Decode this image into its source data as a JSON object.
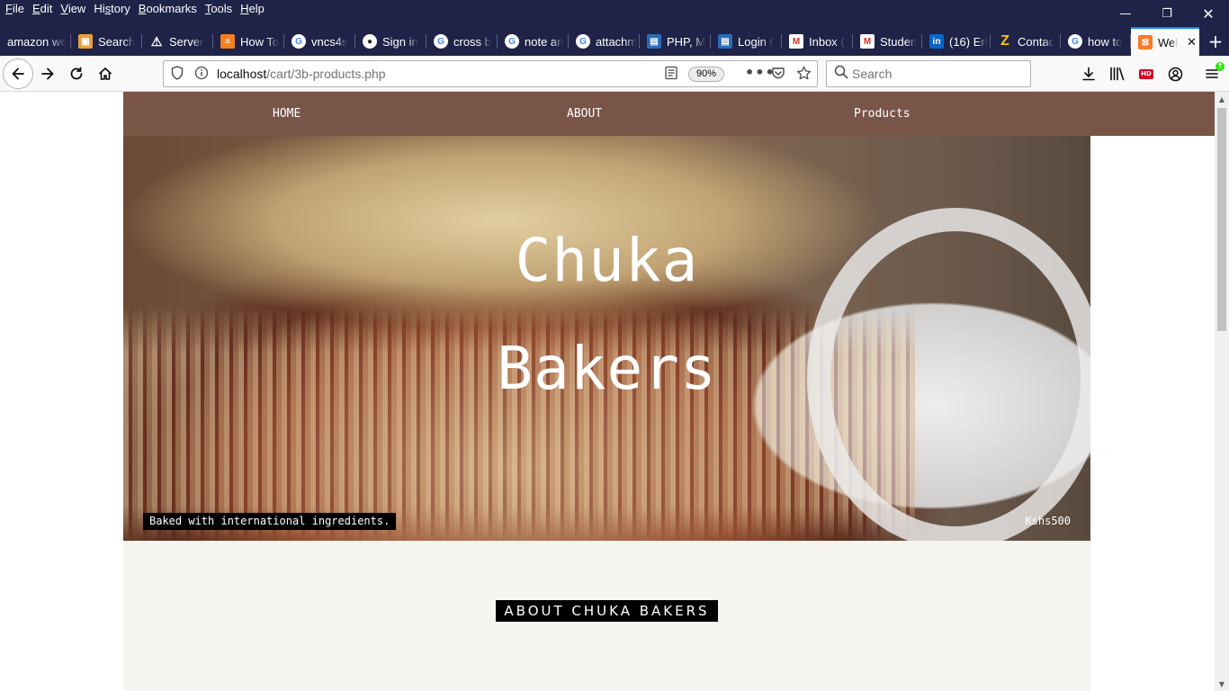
{
  "menubar": {
    "items": [
      {
        "u": "F",
        "rest": "ile"
      },
      {
        "u": "E",
        "rest": "dit"
      },
      {
        "u": "V",
        "rest": "iew"
      },
      {
        "u": "",
        "pre": "Hi",
        "us": "s",
        "post": "tory"
      },
      {
        "u": "B",
        "rest": "ookmarks"
      },
      {
        "u": "T",
        "rest": "ools"
      },
      {
        "u": "H",
        "rest": "elp"
      }
    ],
    "labels": [
      "File",
      "Edit",
      "View",
      "History",
      "Bookmarks",
      "Tools",
      "Help"
    ]
  },
  "window_controls": {
    "minimize": "—",
    "restore": "❐",
    "close": "✕"
  },
  "tabs": [
    {
      "title": "amazon we",
      "icon": "none"
    },
    {
      "title": "Search",
      "icon": "box-icon",
      "color": "#e8a33a"
    },
    {
      "title": "Server",
      "icon": "warning-icon",
      "color": "#ffffff"
    },
    {
      "title": "How To",
      "icon": "stackoverflow-icon",
      "color": "#f48024"
    },
    {
      "title": "vncs4s",
      "icon": "google-icon",
      "color": "#4285f4"
    },
    {
      "title": "Sign in",
      "icon": "github-icon",
      "color": "#24292e"
    },
    {
      "title": "cross b",
      "icon": "google-icon",
      "color": "#4285f4"
    },
    {
      "title": "note an",
      "icon": "google-icon",
      "color": "#4285f4"
    },
    {
      "title": "attachm",
      "icon": "google-icon",
      "color": "#4285f4"
    },
    {
      "title": "PHP, M",
      "icon": "doc-icon",
      "color": "#2a6cb5"
    },
    {
      "title": "Login t",
      "icon": "doc-icon",
      "color": "#2a6cb5"
    },
    {
      "title": "Inbox (",
      "icon": "gmail-icon",
      "color": "#d93025"
    },
    {
      "title": "Studen",
      "icon": "gmail-icon",
      "color": "#d93025"
    },
    {
      "title": "(16) Eri",
      "icon": "linkedin-icon",
      "color": "#0a66c2"
    },
    {
      "title": "Contac",
      "icon": "z-icon",
      "color": "#f5c400"
    },
    {
      "title": "how to",
      "icon": "google-icon",
      "color": "#4285f4"
    },
    {
      "title": "Wel",
      "icon": "xampp-icon",
      "color": "#fb7a24",
      "active": true
    }
  ],
  "newtab": "+",
  "navbar": {
    "url_host": "localhost",
    "url_path": "/cart/3b-products.php",
    "zoom": "90%",
    "search_placeholder": "Search"
  },
  "site": {
    "nav": [
      "HOME",
      "ABOUT",
      "Products"
    ],
    "hero_line1": "Chuka",
    "hero_line2": "Bakers",
    "caption": "Baked with international ingredients.",
    "price": "Kshs500",
    "about_heading": "ABOUT CHUKA BAKERS"
  },
  "colors": {
    "chrome_dark": "#1f2347",
    "site_nav": "#795548",
    "active_tab_accent": "#0a84ff",
    "about_bg": "#f5f4f1"
  }
}
